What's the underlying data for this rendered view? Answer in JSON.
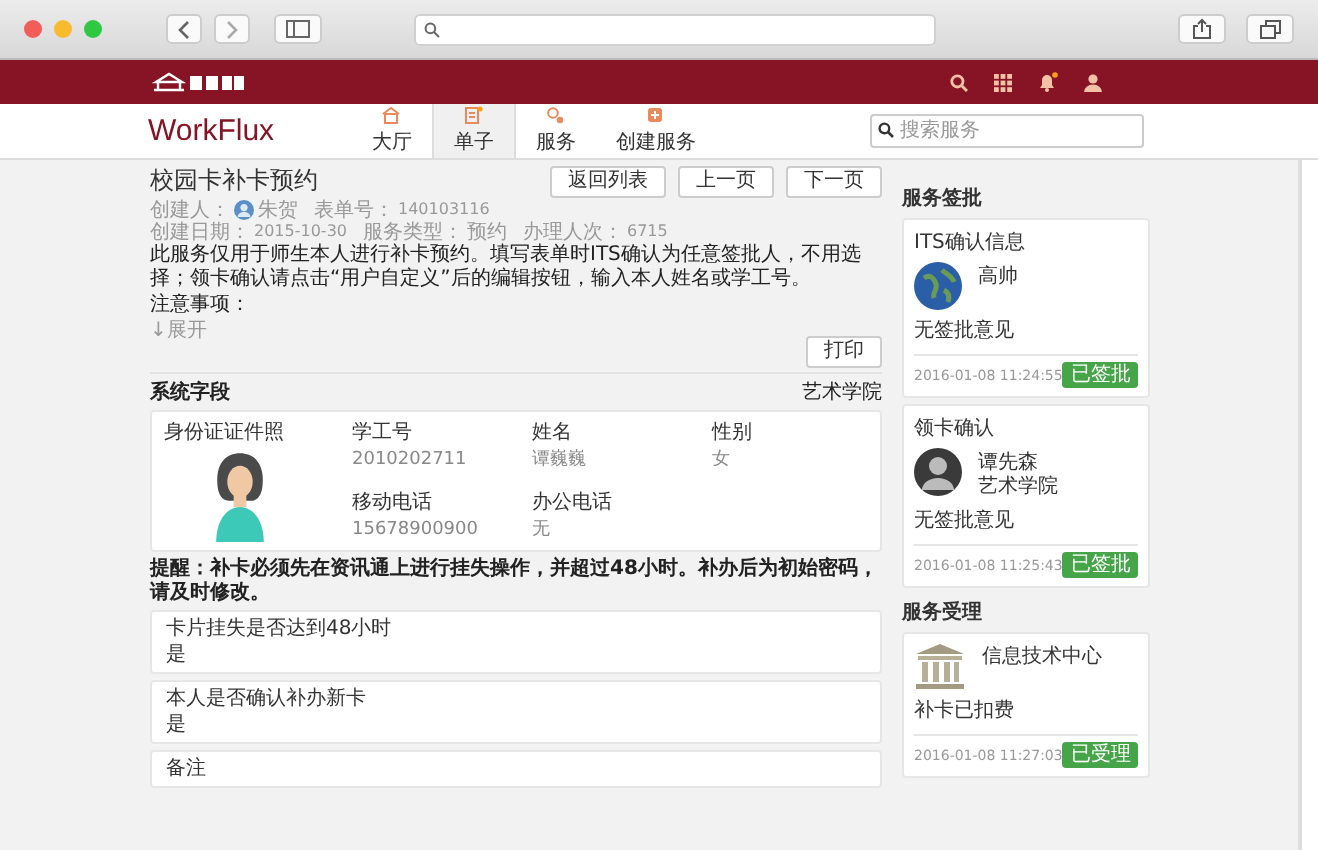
{
  "nav": {
    "brand": "WorkFlux",
    "tabs": [
      {
        "label": "大厅",
        "selected": false
      },
      {
        "label": "单子",
        "selected": true
      },
      {
        "label": "服务",
        "selected": false
      },
      {
        "label": "创建服务",
        "selected": false
      }
    ],
    "search": {
      "placeholder": "搜索服务"
    }
  },
  "request": {
    "title": "校园卡补卡预约",
    "actions": [
      "返回列表",
      "上一页",
      "下一页"
    ],
    "meta_rows": [
      [
        {
          "kind": "person",
          "label": "创建人：",
          "value": "朱贺"
        },
        {
          "kind": "text",
          "label": "表单号：",
          "value": "140103116"
        }
      ],
      [
        {
          "kind": "text",
          "label": "创建日期：",
          "value": "2015-10-30"
        },
        {
          "kind": "text",
          "label": "服务类型：",
          "value": "预约"
        },
        {
          "kind": "text",
          "label": "办理人次：",
          "value": "6715"
        }
      ]
    ],
    "description": [
      "此服务仅用于师生本人进行补卡预约。填写表单时ITS确认为任意签批人，不用选择；领卡确认请点击“用户自定义”后的编辑按钮，输入本人姓名或学工号。",
      "注意事项："
    ],
    "expand": "↓展开",
    "print_button": "打印"
  },
  "section": {
    "title": "系统字段",
    "department": "艺术学院"
  },
  "profile": {
    "photo_label": "身份证证件照",
    "fields": [
      {
        "label": "学工号",
        "value": "2010202711"
      },
      {
        "label": "姓名",
        "value": "谭巍巍"
      },
      {
        "label": "性别",
        "value": "女"
      },
      {
        "label": "移动电话",
        "value": "15678900900"
      },
      {
        "label": "办公电话",
        "value": "无"
      }
    ]
  },
  "notice": "提醒：补卡必须先在资讯通上进行挂失操作，并超过48小时。补办后为初始密码，请及时修改。",
  "answers": [
    {
      "question": "卡片挂失是否达到48小时",
      "answer": "是"
    },
    {
      "question": "本人是否确认补办新卡",
      "answer": "是"
    },
    {
      "question": "备注"
    }
  ],
  "sidebar": [
    {
      "title": "服务签批",
      "cards": [
        {
          "step": "ITS确认信息",
          "kind": "globe",
          "names": [
            "高帅"
          ],
          "comment": "无签批意见",
          "time": "2016-01-08 11:24:55",
          "status": "已签批"
        },
        {
          "step": "领卡确认",
          "kind": "person",
          "names": [
            "谭先森",
            "艺术学院"
          ],
          "comment": "无签批意见",
          "time": "2016-01-08 11:25:43",
          "status": "已签批"
        }
      ]
    },
    {
      "title": "服务受理",
      "cards": [
        {
          "kind": "building",
          "names": [
            "信息技术中心"
          ],
          "comment": "补卡已扣费",
          "time": "2016-01-08 11:27:03",
          "status": "已受理"
        }
      ]
    }
  ]
}
